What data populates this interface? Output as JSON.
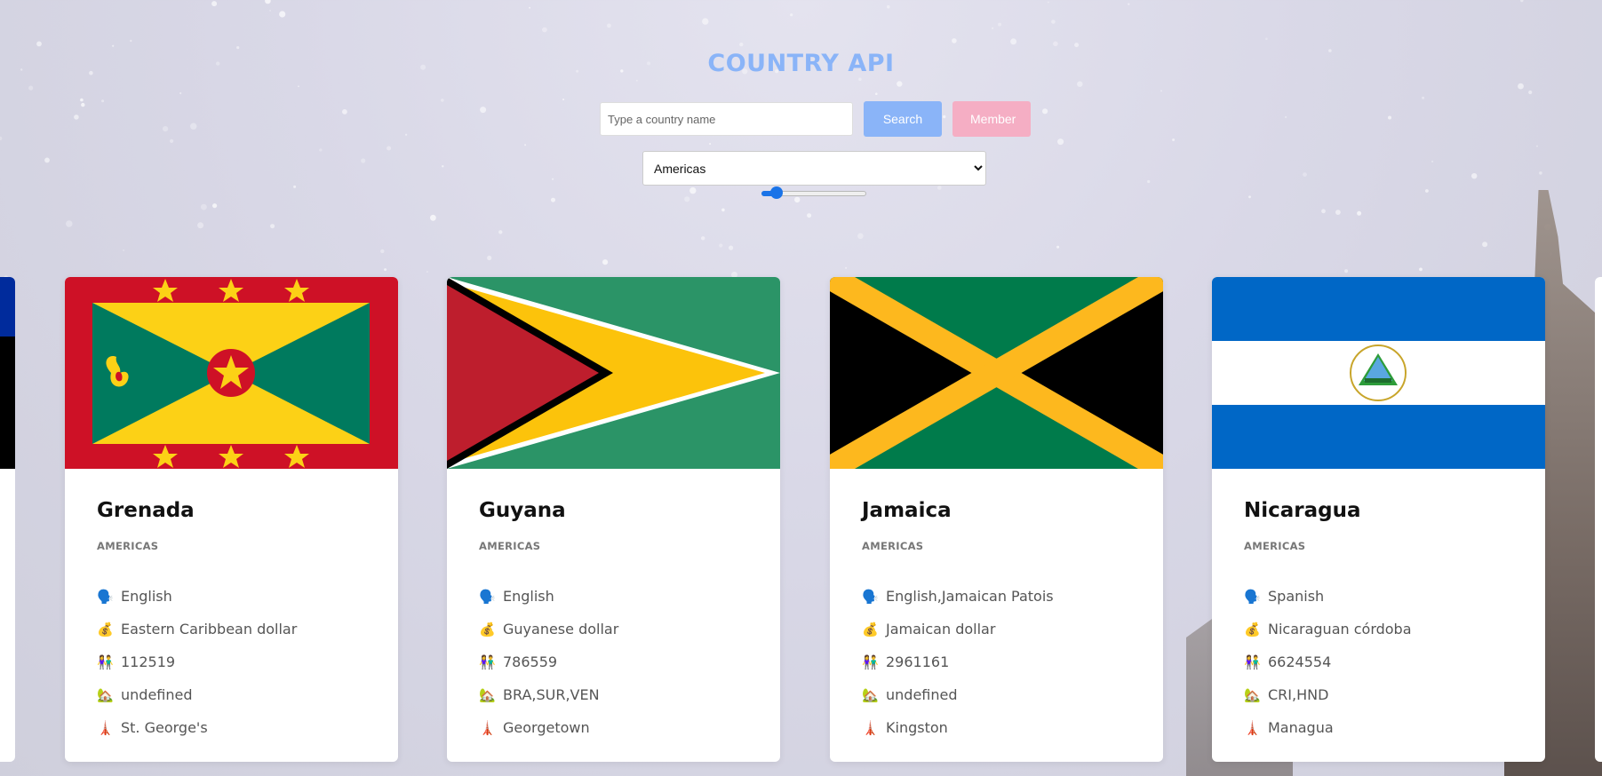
{
  "header": {
    "title": "COUNTRY API",
    "search_placeholder": "Type a country name",
    "search_label": "Search",
    "member_label": "Member",
    "region_selected": "Americas",
    "region_options": [
      "Americas"
    ],
    "slider_value": 0.15
  },
  "colors": {
    "title": "#8ab4f8",
    "search_button": "#8ab4f8",
    "member_button": "#f5aec4"
  },
  "icons": {
    "language": "speaking-head-icon",
    "currency": "money-bag-icon",
    "population": "people-icon",
    "borders": "house-icon",
    "capital": "tower-icon"
  },
  "cards": [
    {
      "name": "Grenada",
      "region": "AMERICAS",
      "languages": "English",
      "currency": "Eastern Caribbean dollar",
      "population": "112519",
      "borders": "undefined",
      "capital": "St. George's"
    },
    {
      "name": "Guyana",
      "region": "AMERICAS",
      "languages": "English",
      "currency": "Guyanese dollar",
      "population": "786559",
      "borders": "BRA,SUR,VEN",
      "capital": "Georgetown"
    },
    {
      "name": "Jamaica",
      "region": "AMERICAS",
      "languages": "English,Jamaican Patois",
      "currency": "Jamaican dollar",
      "population": "2961161",
      "borders": "undefined",
      "capital": "Kingston"
    },
    {
      "name": "Nicaragua",
      "region": "AMERICAS",
      "languages": "Spanish",
      "currency": "Nicaraguan córdoba",
      "population": "6624554",
      "borders": "CRI,HND",
      "capital": "Managua"
    }
  ]
}
